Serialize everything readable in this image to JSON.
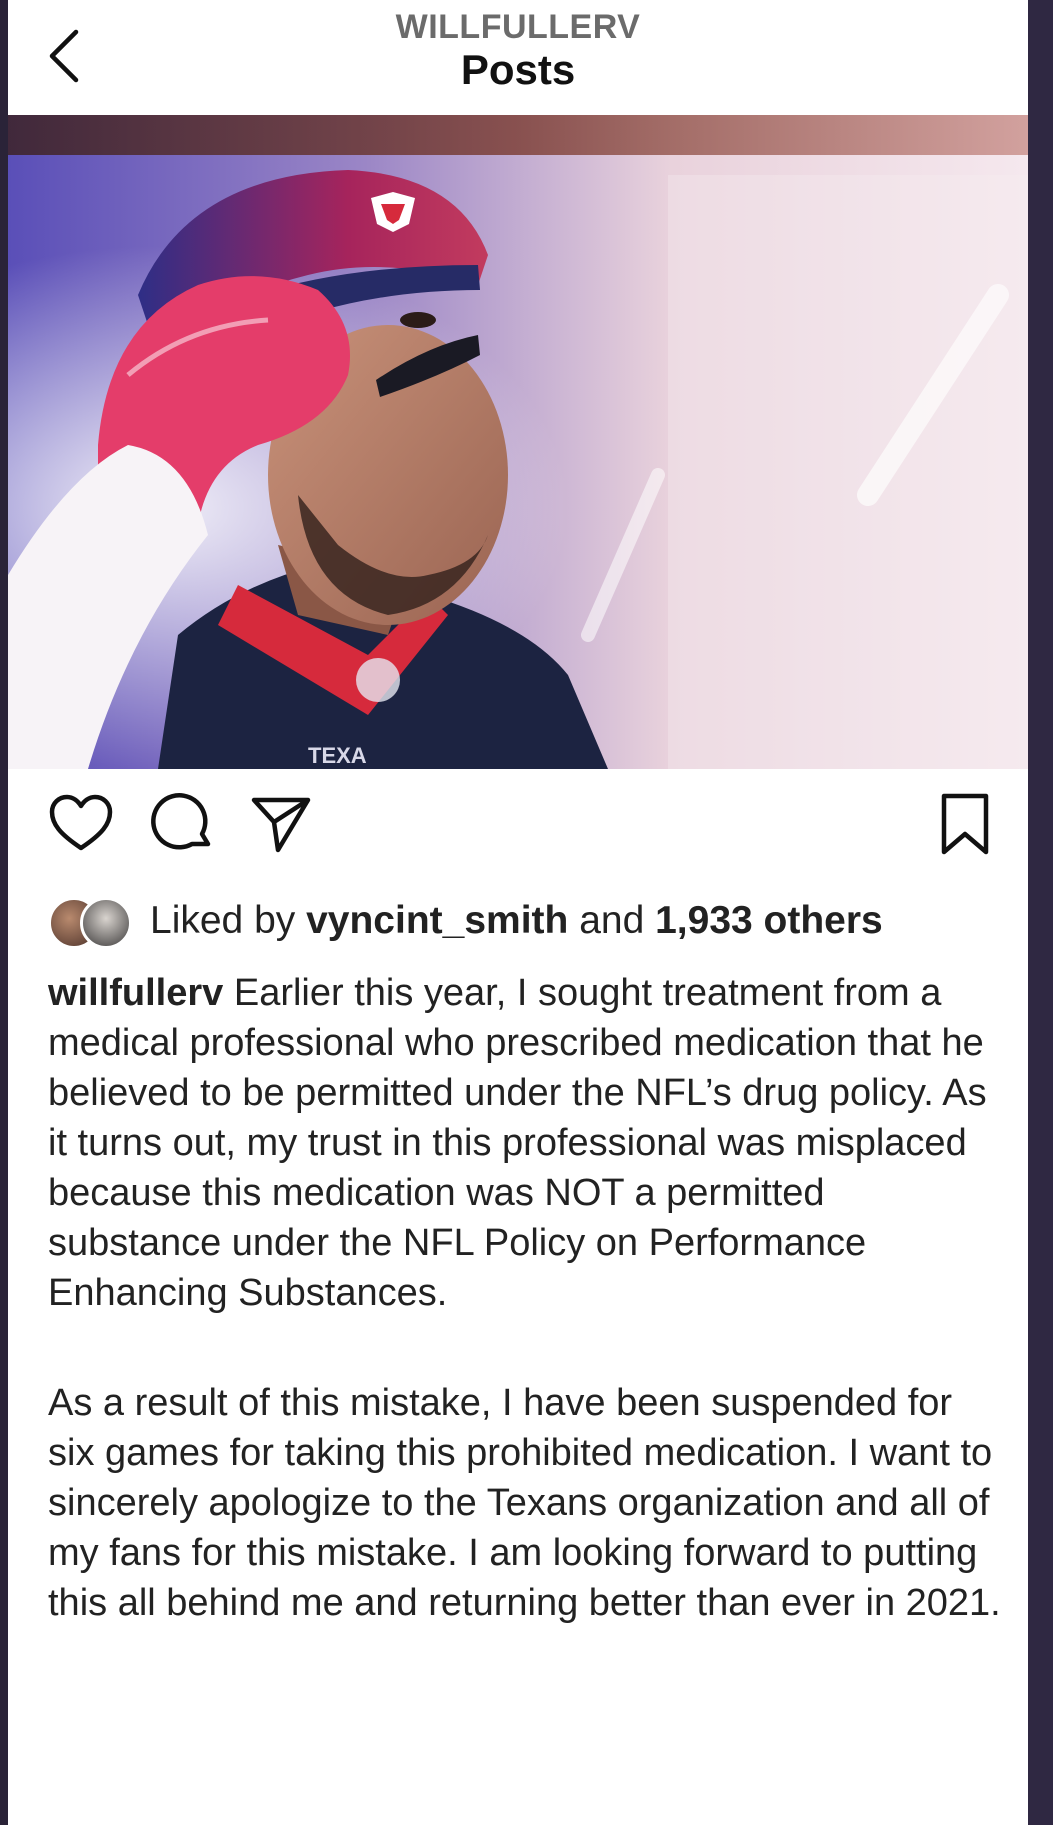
{
  "header": {
    "username": "WILLFULLERV",
    "title": "Posts"
  },
  "icons": {
    "back": "chevron-left-icon",
    "like": "heart-icon",
    "comment": "comment-icon",
    "share": "send-icon",
    "save": "bookmark-icon"
  },
  "likes": {
    "prefix": "Liked by ",
    "user": "vyncint_smith",
    "middle": " and ",
    "count": "1,933 others"
  },
  "caption": {
    "username": "willfullerv",
    "paragraph1": "Earlier this year, I sought treatment from a medical professional who prescribed medication that he believed to be permitted under the NFL’s drug policy.  As it turns out, my trust in this professional was misplaced because this medication was NOT a permitted substance under the NFL Policy on Performance Enhancing Substances.",
    "paragraph2": "As a result of this mistake, I have been suspended for six games for taking this prohibited medication. I want to sincerely apologize to the Texans organization and all of my fans for this mistake.  I am looking forward to putting this all behind me and returning better than ever in 2021."
  },
  "colors": {
    "team_red": "#d62a3c",
    "team_navy": "#1c2341",
    "background_edge": "#2e2840"
  }
}
